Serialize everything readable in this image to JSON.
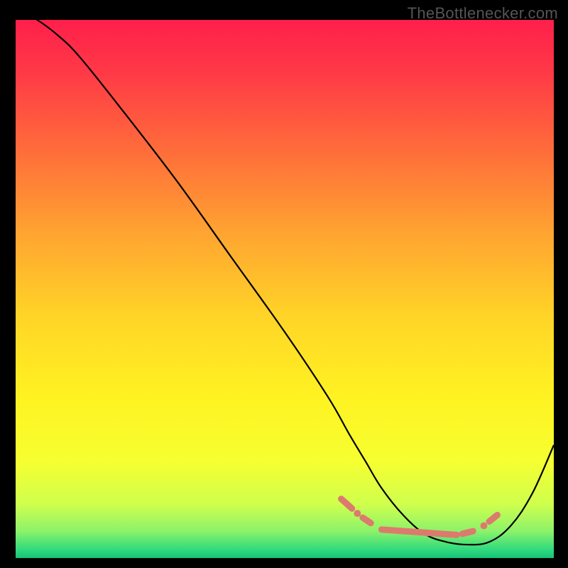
{
  "watermark": "TheBottlenecker.com",
  "chart_data": {
    "type": "line",
    "title": "",
    "xlabel": "",
    "ylabel": "",
    "xlim": [
      0,
      100
    ],
    "ylim": [
      0,
      100
    ],
    "series": [
      {
        "name": "bottleneck-curve",
        "x": [
          0,
          4,
          8,
          12,
          20,
          30,
          40,
          50,
          58,
          62,
          65,
          68,
          72,
          76,
          80,
          84,
          88,
          92,
          96,
          100
        ],
        "y": [
          102,
          100,
          97,
          93,
          83,
          70,
          56,
          42,
          30,
          23,
          18,
          13,
          8,
          4.5,
          3,
          2.5,
          3,
          6,
          12,
          21
        ]
      }
    ],
    "markers": [
      {
        "type": "segment",
        "x1": 60.5,
        "y1": 11.0,
        "x2": 62.5,
        "y2": 9.2
      },
      {
        "type": "dot",
        "x": 63.5,
        "y": 8.3
      },
      {
        "type": "segment",
        "x1": 64.5,
        "y1": 7.5,
        "x2": 66.0,
        "y2": 6.5
      },
      {
        "type": "segment",
        "x1": 68.0,
        "y1": 5.3,
        "x2": 82.0,
        "y2": 4.3
      },
      {
        "type": "segment",
        "x1": 83.0,
        "y1": 4.5,
        "x2": 85.0,
        "y2": 5.0
      },
      {
        "type": "dot",
        "x": 87.0,
        "y": 6.0
      },
      {
        "type": "segment",
        "x1": 88.0,
        "y1": 6.8,
        "x2": 89.5,
        "y2": 8.0
      }
    ],
    "background": {
      "kind": "vertical-gradient",
      "stops": [
        {
          "offset": 0.0,
          "color": "#ff1f4b"
        },
        {
          "offset": 0.1,
          "color": "#ff3a46"
        },
        {
          "offset": 0.25,
          "color": "#ff6f3a"
        },
        {
          "offset": 0.4,
          "color": "#ffa531"
        },
        {
          "offset": 0.55,
          "color": "#ffd427"
        },
        {
          "offset": 0.7,
          "color": "#fff222"
        },
        {
          "offset": 0.82,
          "color": "#f6ff30"
        },
        {
          "offset": 0.9,
          "color": "#cfff4d"
        },
        {
          "offset": 0.95,
          "color": "#8cf26a"
        },
        {
          "offset": 0.985,
          "color": "#2ed97e"
        },
        {
          "offset": 1.0,
          "color": "#17c276"
        }
      ]
    }
  }
}
